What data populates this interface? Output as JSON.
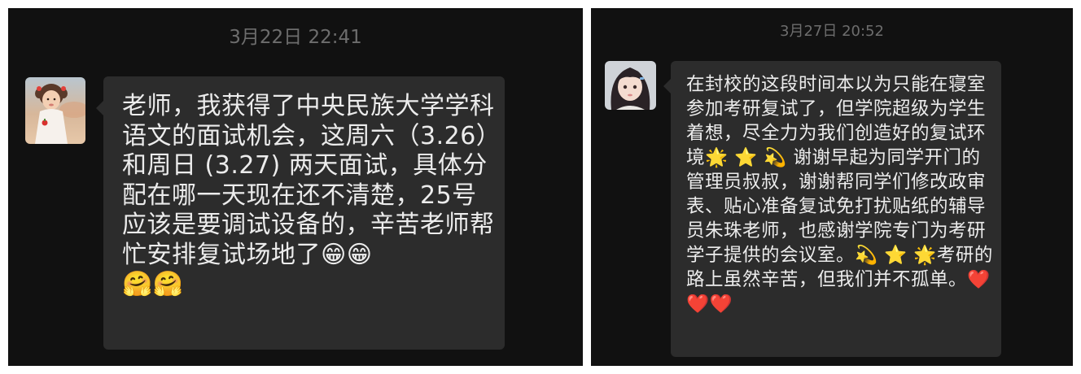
{
  "left_chat": {
    "timestamp": "3月22日 22:41",
    "message": "老师，我获得了中央民族大学学科语文的面试机会，这周六（3.26）和周日 (3.27) 两天面试，具体分配在哪一天现在还不清楚，25号应该是要调试设备的，辛苦老师帮忙安排复试场地了😁😁",
    "message_end_emojis": "🤗🤗",
    "avatar_icon": "avatar-toddler-photo"
  },
  "right_chat": {
    "timestamp": "3月27日 20:52",
    "message": "在封校的这段时间本以为只能在寝室参加考研复试了，但学院超级为学生着想，尽全力为我们创造好的复试环境🌟 ⭐ 💫 谢谢早起为同学开门的管理员叔叔，谢谢帮同学们修改政审表、贴心准备复试免打扰贴纸的辅导员朱珠老师，也感谢学院专门为考研学子提供的会议室。💫 ⭐ 🌟考研的路上虽然辛苦，但我们并不孤单。❤️❤️❤️",
    "avatar_icon": "avatar-girl-photo"
  },
  "colors": {
    "chat_background": "#111111",
    "bubble_background": "#2c2c2c",
    "message_text": "#ececec",
    "timestamp_text": "#6d6d6d"
  }
}
